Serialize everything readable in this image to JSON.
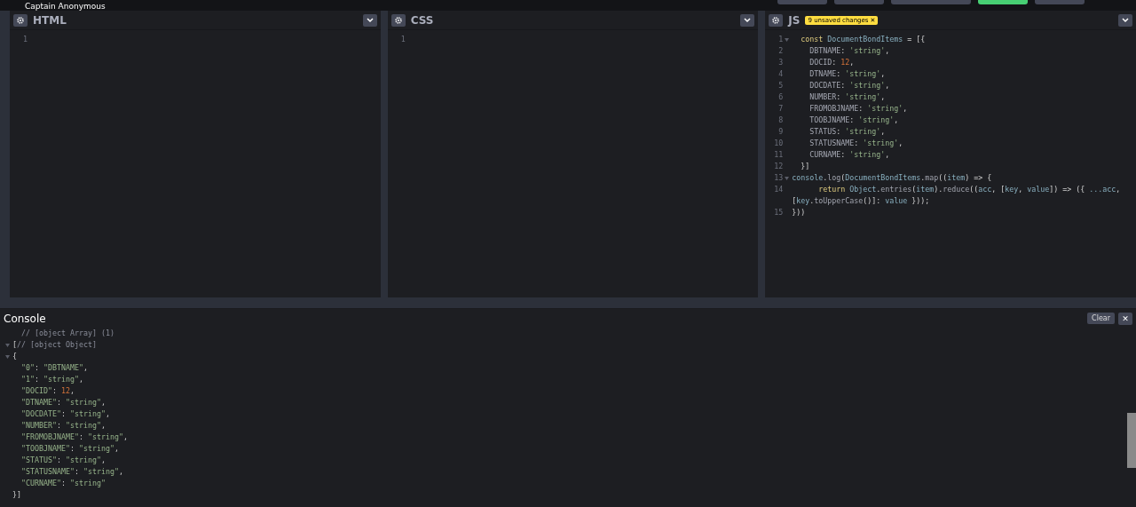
{
  "top_bar": {
    "user": "Captain Anonymous",
    "buttons": [
      {
        "kind": "plain"
      },
      {
        "kind": "plain"
      },
      {
        "kind": "wide"
      },
      {
        "kind": "save"
      },
      {
        "kind": "plain"
      }
    ]
  },
  "editors": [
    {
      "title": "HTML",
      "lines": [
        {
          "no": "1",
          "foldable": false
        }
      ]
    },
    {
      "title": "CSS",
      "lines": [
        {
          "no": "1",
          "foldable": false
        }
      ]
    },
    {
      "title": "JS",
      "badge": {
        "label": "9 unsaved changes",
        "close": "✕"
      },
      "lines": [
        {
          "no": "1",
          "foldable": true,
          "tokens": [
            {
              "kind": "keyword",
              "text": "  const "
            },
            {
              "kind": "variable",
              "text": "DocumentBondItems"
            },
            {
              "kind": "punctuation",
              "text": " = [{"
            }
          ]
        },
        {
          "no": "2",
          "foldable": false,
          "tokens": [
            {
              "kind": "property",
              "text": "    DBTNAME"
            },
            {
              "kind": "punctuation",
              "text": ": "
            },
            {
              "kind": "string",
              "text": "'string'"
            },
            {
              "kind": "punctuation",
              "text": ","
            }
          ]
        },
        {
          "no": "3",
          "foldable": false,
          "tokens": [
            {
              "kind": "property",
              "text": "    DOCID"
            },
            {
              "kind": "punctuation",
              "text": ": "
            },
            {
              "kind": "number",
              "text": "12"
            },
            {
              "kind": "punctuation",
              "text": ","
            }
          ]
        },
        {
          "no": "4",
          "foldable": false,
          "tokens": [
            {
              "kind": "property",
              "text": "    DTNAME"
            },
            {
              "kind": "punctuation",
              "text": ": "
            },
            {
              "kind": "string",
              "text": "'string'"
            },
            {
              "kind": "punctuation",
              "text": ","
            }
          ]
        },
        {
          "no": "5",
          "foldable": false,
          "tokens": [
            {
              "kind": "property",
              "text": "    DOCDATE"
            },
            {
              "kind": "punctuation",
              "text": ": "
            },
            {
              "kind": "string",
              "text": "'string'"
            },
            {
              "kind": "punctuation",
              "text": ","
            }
          ]
        },
        {
          "no": "6",
          "foldable": false,
          "tokens": [
            {
              "kind": "property",
              "text": "    NUMBER"
            },
            {
              "kind": "punctuation",
              "text": ": "
            },
            {
              "kind": "string",
              "text": "'string'"
            },
            {
              "kind": "punctuation",
              "text": ","
            }
          ]
        },
        {
          "no": "7",
          "foldable": false,
          "tokens": [
            {
              "kind": "property",
              "text": "    FROMOBJNAME"
            },
            {
              "kind": "punctuation",
              "text": ": "
            },
            {
              "kind": "string",
              "text": "'string'"
            },
            {
              "kind": "punctuation",
              "text": ","
            }
          ]
        },
        {
          "no": "8",
          "foldable": false,
          "tokens": [
            {
              "kind": "property",
              "text": "    TOOBJNAME"
            },
            {
              "kind": "punctuation",
              "text": ": "
            },
            {
              "kind": "string",
              "text": "'string'"
            },
            {
              "kind": "punctuation",
              "text": ","
            }
          ]
        },
        {
          "no": "9",
          "foldable": false,
          "tokens": [
            {
              "kind": "property",
              "text": "    STATUS"
            },
            {
              "kind": "punctuation",
              "text": ": "
            },
            {
              "kind": "string",
              "text": "'string'"
            },
            {
              "kind": "punctuation",
              "text": ","
            }
          ]
        },
        {
          "no": "10",
          "foldable": false,
          "tokens": [
            {
              "kind": "property",
              "text": "    STATUSNAME"
            },
            {
              "kind": "punctuation",
              "text": ": "
            },
            {
              "kind": "string",
              "text": "'string'"
            },
            {
              "kind": "punctuation",
              "text": ","
            }
          ]
        },
        {
          "no": "11",
          "foldable": false,
          "tokens": [
            {
              "kind": "property",
              "text": "    CURNAME"
            },
            {
              "kind": "punctuation",
              "text": ": "
            },
            {
              "kind": "string",
              "text": "'string'"
            },
            {
              "kind": "punctuation",
              "text": ","
            }
          ]
        },
        {
          "no": "12",
          "foldable": false,
          "tokens": [
            {
              "kind": "punctuation",
              "text": "  }]"
            }
          ]
        },
        {
          "no": "13",
          "foldable": true,
          "tokens": [
            {
              "kind": "variable",
              "text": "console"
            },
            {
              "kind": "punctuation",
              "text": "."
            },
            {
              "kind": "function",
              "text": "log"
            },
            {
              "kind": "punctuation",
              "text": "("
            },
            {
              "kind": "variable",
              "text": "DocumentBondItems"
            },
            {
              "kind": "punctuation",
              "text": "."
            },
            {
              "kind": "function",
              "text": "map"
            },
            {
              "kind": "punctuation",
              "text": "(("
            },
            {
              "kind": "variable",
              "text": "item"
            },
            {
              "kind": "punctuation",
              "text": ") => {"
            }
          ]
        },
        {
          "no": "14",
          "foldable": false,
          "tokens": [
            {
              "kind": "keyword",
              "text": "      return "
            },
            {
              "kind": "variable",
              "text": "Object"
            },
            {
              "kind": "punctuation",
              "text": "."
            },
            {
              "kind": "function",
              "text": "entries"
            },
            {
              "kind": "punctuation",
              "text": "("
            },
            {
              "kind": "variable",
              "text": "item"
            },
            {
              "kind": "punctuation",
              "text": ")."
            },
            {
              "kind": "function",
              "text": "reduce"
            },
            {
              "kind": "punctuation",
              "text": "(("
            },
            {
              "kind": "variable",
              "text": "acc"
            },
            {
              "kind": "punctuation",
              "text": ", ["
            },
            {
              "kind": "variable",
              "text": "key"
            },
            {
              "kind": "punctuation",
              "text": ", "
            },
            {
              "kind": "variable",
              "text": "value"
            },
            {
              "kind": "punctuation",
              "text": "]) => ({ "
            },
            {
              "kind": "variable",
              "text": "...acc"
            },
            {
              "kind": "punctuation",
              "text": ", ["
            },
            {
              "kind": "variable",
              "text": "key"
            },
            {
              "kind": "punctuation",
              "text": "."
            },
            {
              "kind": "function",
              "text": "toUpperCase"
            },
            {
              "kind": "punctuation",
              "text": "()]: "
            },
            {
              "kind": "variable",
              "text": "value"
            },
            {
              "kind": "punctuation",
              "text": " }));"
            }
          ]
        },
        {
          "no": "15",
          "foldable": false,
          "tokens": [
            {
              "kind": "punctuation",
              "text": "}))"
            }
          ]
        }
      ]
    }
  ],
  "console": {
    "title": "Console",
    "clear": "Clear",
    "close": "✕",
    "lines": [
      {
        "foldable": false,
        "tokens": [
          {
            "kind": "comment",
            "text": "  // [object Array] (1)"
          }
        ]
      },
      {
        "foldable": true,
        "tokens": [
          {
            "kind": "punctuation",
            "text": "["
          },
          {
            "kind": "comment",
            "text": "// [object Object]"
          }
        ]
      },
      {
        "foldable": true,
        "tokens": [
          {
            "kind": "punctuation",
            "text": "{"
          }
        ]
      },
      {
        "foldable": false,
        "tokens": [
          {
            "kind": "string",
            "text": "  \"0\""
          },
          {
            "kind": "punctuation",
            "text": ": "
          },
          {
            "kind": "string",
            "text": "\"DBTNAME\""
          },
          {
            "kind": "punctuation",
            "text": ","
          }
        ]
      },
      {
        "foldable": false,
        "tokens": [
          {
            "kind": "string",
            "text": "  \"1\""
          },
          {
            "kind": "punctuation",
            "text": ": "
          },
          {
            "kind": "string",
            "text": "\"string\""
          },
          {
            "kind": "punctuation",
            "text": ","
          }
        ]
      },
      {
        "foldable": false,
        "tokens": [
          {
            "kind": "string",
            "text": "  \"DOCID\""
          },
          {
            "kind": "punctuation",
            "text": ": "
          },
          {
            "kind": "number",
            "text": "12"
          },
          {
            "kind": "punctuation",
            "text": ","
          }
        ]
      },
      {
        "foldable": false,
        "tokens": [
          {
            "kind": "string",
            "text": "  \"DTNAME\""
          },
          {
            "kind": "punctuation",
            "text": ": "
          },
          {
            "kind": "string",
            "text": "\"string\""
          },
          {
            "kind": "punctuation",
            "text": ","
          }
        ]
      },
      {
        "foldable": false,
        "tokens": [
          {
            "kind": "string",
            "text": "  \"DOCDATE\""
          },
          {
            "kind": "punctuation",
            "text": ": "
          },
          {
            "kind": "string",
            "text": "\"string\""
          },
          {
            "kind": "punctuation",
            "text": ","
          }
        ]
      },
      {
        "foldable": false,
        "tokens": [
          {
            "kind": "string",
            "text": "  \"NUMBER\""
          },
          {
            "kind": "punctuation",
            "text": ": "
          },
          {
            "kind": "string",
            "text": "\"string\""
          },
          {
            "kind": "punctuation",
            "text": ","
          }
        ]
      },
      {
        "foldable": false,
        "tokens": [
          {
            "kind": "string",
            "text": "  \"FROMOBJNAME\""
          },
          {
            "kind": "punctuation",
            "text": ": "
          },
          {
            "kind": "string",
            "text": "\"string\""
          },
          {
            "kind": "punctuation",
            "text": ","
          }
        ]
      },
      {
        "foldable": false,
        "tokens": [
          {
            "kind": "string",
            "text": "  \"TOOBJNAME\""
          },
          {
            "kind": "punctuation",
            "text": ": "
          },
          {
            "kind": "string",
            "text": "\"string\""
          },
          {
            "kind": "punctuation",
            "text": ","
          }
        ]
      },
      {
        "foldable": false,
        "tokens": [
          {
            "kind": "string",
            "text": "  \"STATUS\""
          },
          {
            "kind": "punctuation",
            "text": ": "
          },
          {
            "kind": "string",
            "text": "\"string\""
          },
          {
            "kind": "punctuation",
            "text": ","
          }
        ]
      },
      {
        "foldable": false,
        "tokens": [
          {
            "kind": "string",
            "text": "  \"STATUSNAME\""
          },
          {
            "kind": "punctuation",
            "text": ": "
          },
          {
            "kind": "string",
            "text": "\"string\""
          },
          {
            "kind": "punctuation",
            "text": ","
          }
        ]
      },
      {
        "foldable": false,
        "tokens": [
          {
            "kind": "string",
            "text": "  \"CURNAME\""
          },
          {
            "kind": "punctuation",
            "text": ": "
          },
          {
            "kind": "string",
            "text": "\"string\""
          }
        ]
      },
      {
        "foldable": false,
        "tokens": [
          {
            "kind": "punctuation",
            "text": "}]"
          }
        ]
      }
    ]
  }
}
